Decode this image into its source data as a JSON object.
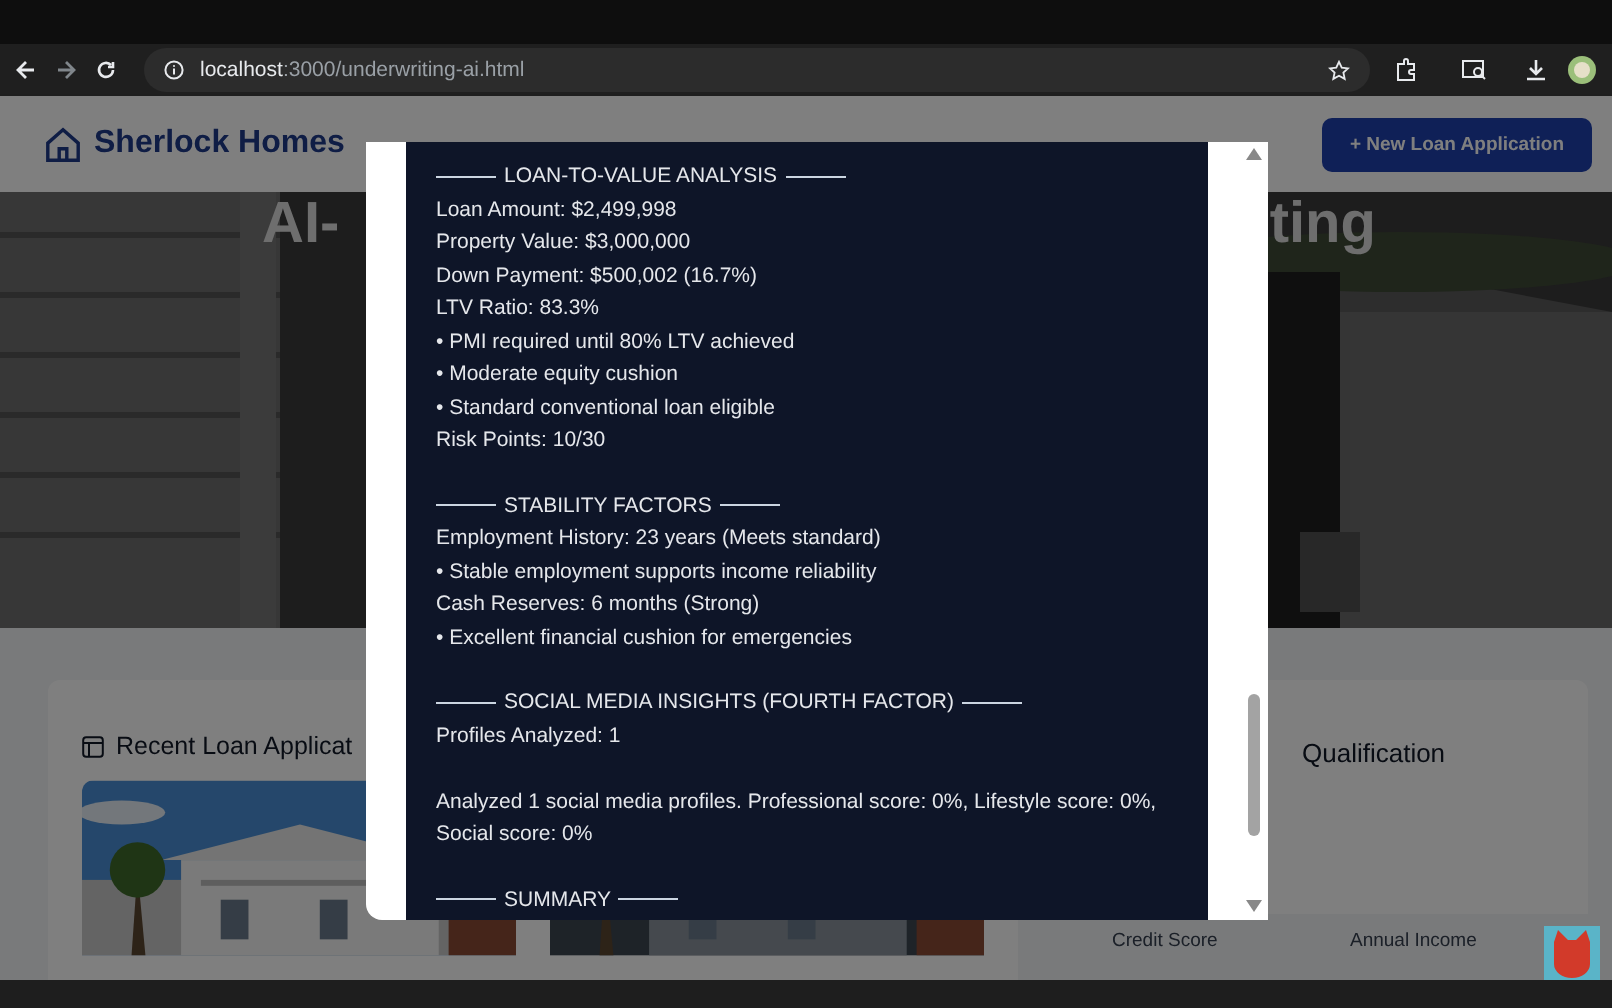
{
  "browser": {
    "url_host": "localhost",
    "url_rest": ":3000/underwriting-ai.html"
  },
  "header": {
    "brand": "Sherlock Homes",
    "action": "+ New Loan Application"
  },
  "hero": {
    "title_left": "AI-",
    "title_right": "ting"
  },
  "recent": {
    "title": "Recent Loan Applicat"
  },
  "qualification": {
    "title": "Qualification",
    "columns": [
      "Credit Score",
      "Annual Income"
    ]
  },
  "report": {
    "sections": [
      {
        "heading": "LOAN-TO-VALUE ANALYSIS",
        "blocks": [
          [
            "Loan Amount: $2,499,998",
            "Property Value: $3,000,000",
            "Down Payment: $500,002 (16.7%)",
            "LTV Ratio: 83.3%",
            "• PMI required until 80% LTV achieved",
            "• Moderate equity cushion",
            "• Standard conventional loan eligible",
            "Risk Points: 10/30"
          ]
        ]
      },
      {
        "heading": "STABILITY FACTORS",
        "blocks": [
          [
            "Employment History: 23 years (Meets standard)",
            "• Stable employment supports income reliability",
            "Cash Reserves: 6 months (Strong)",
            "• Excellent financial cushion for emergencies"
          ]
        ]
      },
      {
        "heading": "SOCIAL MEDIA INSIGHTS (FOURTH FACTOR)",
        "blocks": [
          [
            "Profiles Analyzed: 1"
          ],
          [
            "Analyzed 1 social media profiles. Professional score: 0%, Lifestyle score: 0%, Social score: 0%"
          ]
        ]
      },
      {
        "heading": "SUMMARY"
      }
    ]
  }
}
